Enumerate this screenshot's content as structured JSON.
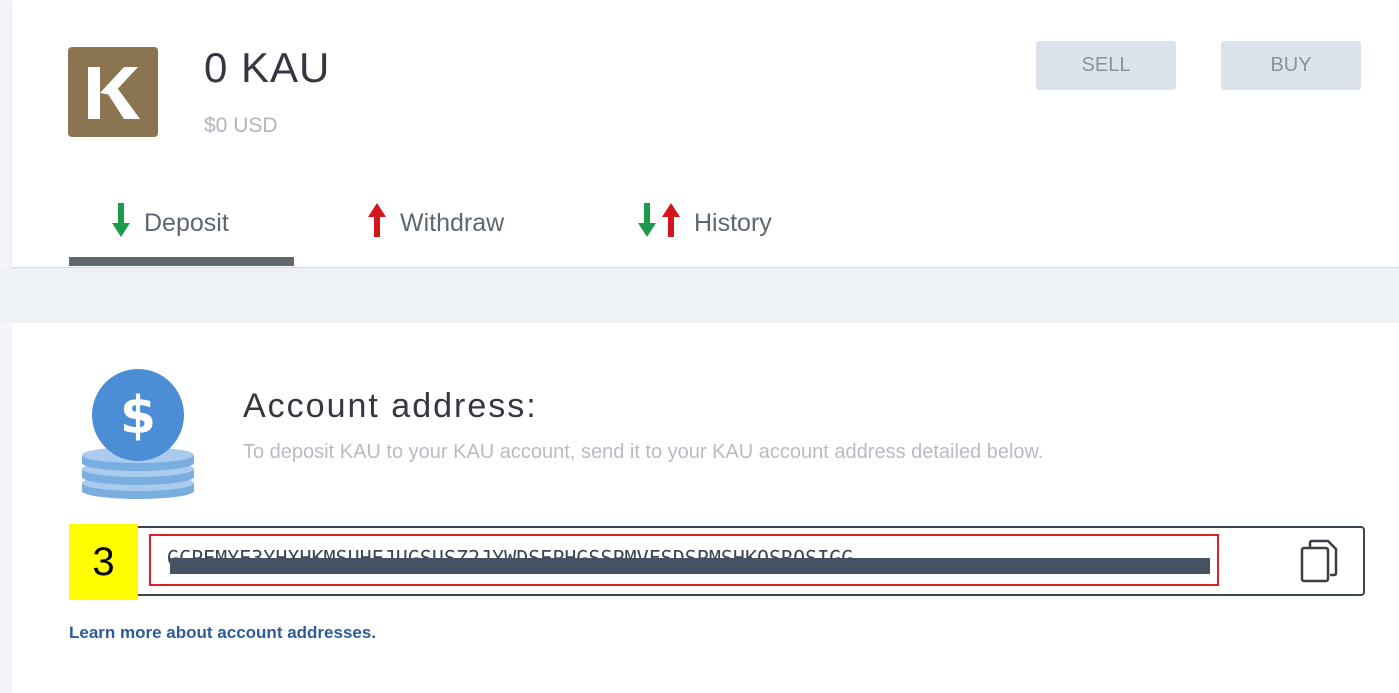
{
  "asset": {
    "logo_letter": "K",
    "balance": "0 KAU",
    "balance_usd": "$0 USD"
  },
  "actions": {
    "sell_label": "SELL",
    "buy_label": "BUY"
  },
  "tabs": [
    {
      "label": "Deposit",
      "active": true
    },
    {
      "label": "Withdraw",
      "active": false
    },
    {
      "label": "History",
      "active": false
    }
  ],
  "deposit": {
    "title": "Account address:",
    "description": "To deposit KAU to your KAU account, send it to your KAU account address detailed below.",
    "address": "GCPEMYE3YHXHKMSUHEJUGSUSZ2JYWDSEPHGSSPMVFSDSPMSHKOSROSIGG",
    "step_marker": "3",
    "learn_more": "Learn more about account addresses."
  },
  "colors": {
    "brand_gold": "#8a7550",
    "deposit_arrow": "#1a9a4a",
    "withdraw_arrow": "#d4161c",
    "link": "#2e5b9a",
    "highlight_box": "#e02020",
    "step_marker_bg": "#ffff00"
  },
  "icons": [
    "kau-logo-icon",
    "arrow-down-icon",
    "arrow-up-icon",
    "coin-stack-icon",
    "copy-icon"
  ]
}
